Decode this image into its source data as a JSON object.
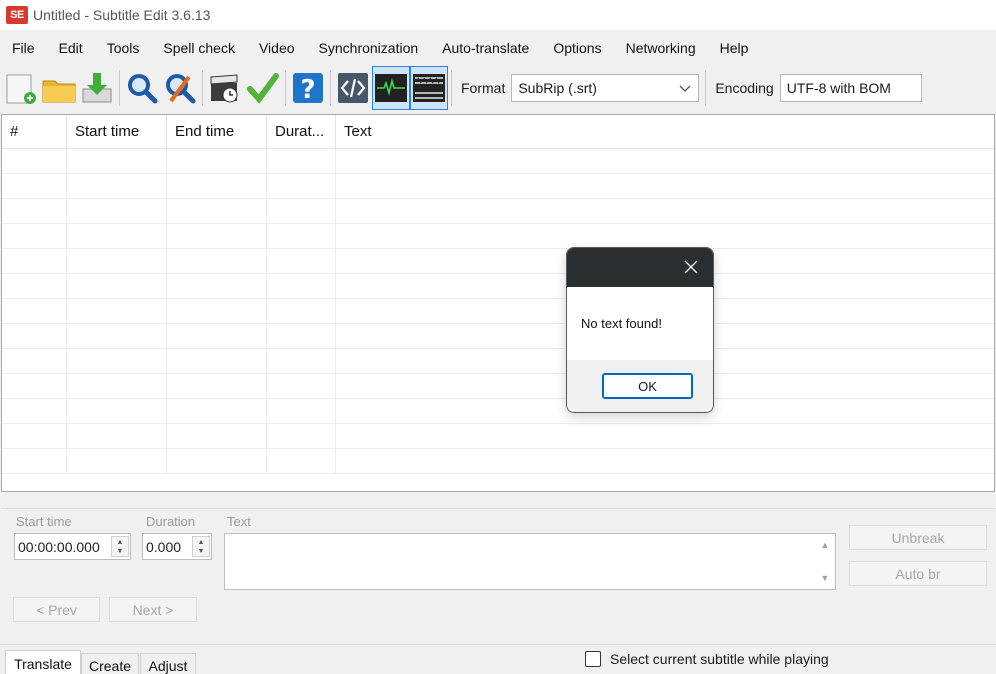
{
  "window": {
    "title": "Untitled - Subtitle Edit 3.6.13",
    "logo_text": "SE"
  },
  "menu": [
    "File",
    "Edit",
    "Tools",
    "Spell check",
    "Video",
    "Synchronization",
    "Auto-translate",
    "Options",
    "Networking",
    "Help"
  ],
  "toolbar": {
    "format_label": "Format",
    "format_value": "SubRip (.srt)",
    "encoding_label": "Encoding",
    "encoding_value": "UTF-8 with BOM"
  },
  "grid": {
    "columns": [
      "#",
      "Start time",
      "End time",
      "Durat...",
      "Text"
    ],
    "rows": 13
  },
  "edit_panel": {
    "start_time_label": "Start time",
    "start_time_value": "00:00:00.000",
    "duration_label": "Duration",
    "duration_value": "0.000",
    "text_label": "Text",
    "unbreak_label": "Unbreak",
    "auto_br_label": "Auto br",
    "prev_label": "< Prev",
    "next_label": "Next >"
  },
  "tabs": [
    "Translate",
    "Create",
    "Adjust"
  ],
  "select_while_playing_label": "Select current subtitle while playing",
  "dialog": {
    "message": "No text found!",
    "ok_label": "OK"
  },
  "colors": {
    "logo": "#d83b2c",
    "accent": "#0067c0",
    "dialog_titlebar": "#2b2d31",
    "toggle_border": "#2d83d6"
  }
}
